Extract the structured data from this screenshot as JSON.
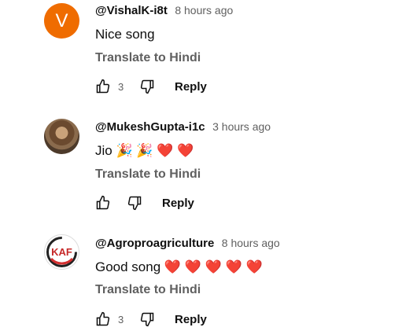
{
  "comments": [
    {
      "avatar_letter": "V",
      "author": "@VishalK-i8t",
      "time": "8 hours ago",
      "text": "Nice song",
      "translate": "Translate to Hindi",
      "likes": "3",
      "reply": "Reply"
    },
    {
      "author": "@MukeshGupta-i1c",
      "time": "3 hours ago",
      "text": "Jio 🎉 🎉 ❤️ ❤️",
      "translate": "Translate to Hindi",
      "reply": "Reply"
    },
    {
      "avatar_logo_text": "KAF",
      "author": "@Agroproagriculture",
      "time": "8 hours ago",
      "text": "Good song ❤️ ❤️ ❤️ ❤️ ❤️",
      "translate": "Translate to Hindi",
      "likes": "3",
      "reply": "Reply"
    }
  ],
  "icons": {
    "like": "thumbs-up-icon",
    "dislike": "thumbs-down-icon"
  },
  "colors": {
    "avatar_v": "#ef6c00",
    "secondary_text": "#606060",
    "primary_text": "#0f0f0f"
  }
}
